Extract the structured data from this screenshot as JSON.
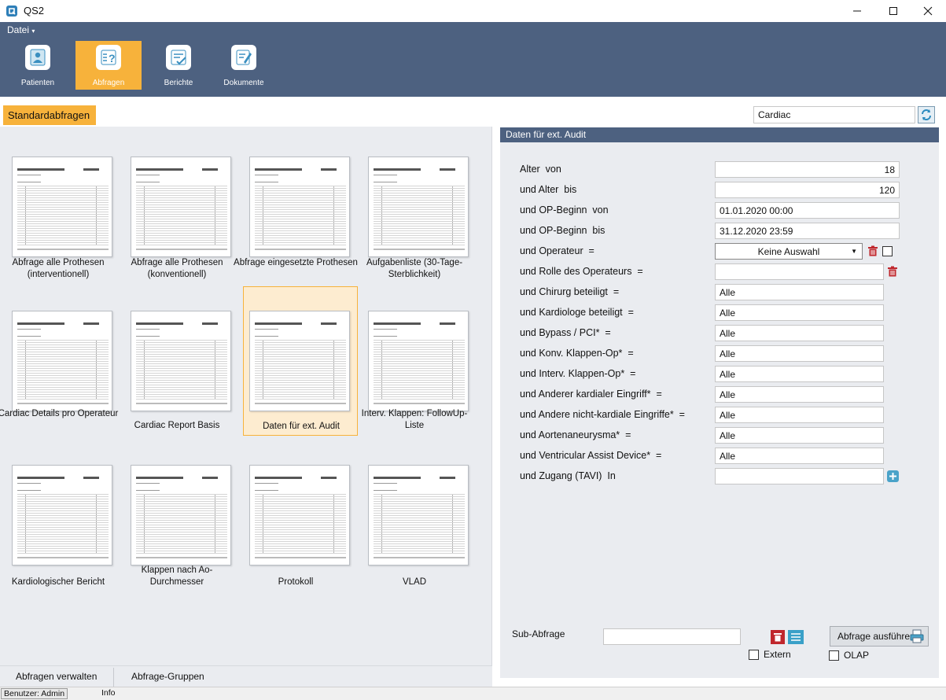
{
  "window": {
    "title": "QS2"
  },
  "ribbon": {
    "menu_label": "Datei",
    "buttons": [
      {
        "label": "Patienten",
        "icon": "patient-icon"
      },
      {
        "label": "Abfragen",
        "icon": "question-doc-icon"
      },
      {
        "label": "Berichte",
        "icon": "checklist-icon"
      },
      {
        "label": "Dokumente",
        "icon": "edit-doc-icon"
      }
    ],
    "active_index": 1
  },
  "toolbar": {
    "tab_label": "Standardabfragen",
    "search_value": "Cardiac"
  },
  "queries": {
    "selected_index": 6,
    "items": [
      {
        "label": "Abfrage alle Prothesen (interventionell)"
      },
      {
        "label": "Abfrage alle Prothesen (konventionell)"
      },
      {
        "label": "Abfrage eingesetzte Prothesen"
      },
      {
        "label": "Aufgabenliste (30-Tage-Sterblichkeit)"
      },
      {
        "label": "Cardiac Details pro Operateur"
      },
      {
        "label": "Cardiac Report Basis"
      },
      {
        "label": "Daten für ext. Audit"
      },
      {
        "label": "Interv. Klappen: FollowUp-Liste"
      },
      {
        "label": "Kardiologischer Bericht"
      },
      {
        "label": "Klappen nach Ao-Durchmesser"
      },
      {
        "label": "Protokoll"
      },
      {
        "label": "VLAD"
      }
    ]
  },
  "left_footer": {
    "manage_label": "Abfragen verwalten",
    "groups_label": "Abfrage-Gruppen"
  },
  "detail": {
    "header": "Daten für ext. Audit",
    "fields": [
      {
        "label": "Alter  von",
        "value": "18"
      },
      {
        "label": "und Alter  bis",
        "value": "120"
      },
      {
        "label": "und OP-Beginn  von",
        "value": "01.01.2020 00:00"
      },
      {
        "label": "und OP-Beginn  bis",
        "value": "31.12.2020 23:59"
      },
      {
        "label": "und Operateur  =",
        "value": "Keine Auswahl"
      },
      {
        "label": "und Rolle des Operateurs  =",
        "value": ""
      },
      {
        "label": "und Chirurg beteiligt  =",
        "value": "Alle"
      },
      {
        "label": "und Kardiologe beteiligt  =",
        "value": "Alle"
      },
      {
        "label": "und Bypass / PCI*  =",
        "value": "Alle"
      },
      {
        "label": "und Konv. Klappen-Op*  =",
        "value": "Alle"
      },
      {
        "label": "und Interv. Klappen-Op*  =",
        "value": "Alle"
      },
      {
        "label": "und Anderer kardialer Eingriff*  =",
        "value": "Alle"
      },
      {
        "label": "und Andere nicht-kardiale Eingriffe*  =",
        "value": "Alle"
      },
      {
        "label": "und Aortenaneurysma*  =",
        "value": "Alle"
      },
      {
        "label": "und Ventricular Assist Device*  =",
        "value": "Alle"
      },
      {
        "label": "und Zugang (TAVI)  In",
        "value": ""
      }
    ],
    "sub_query_label": "Sub-Abfrage",
    "sub_query_value": "",
    "run_label": "Abfrage ausführen",
    "extern_label": "Extern",
    "olap_label": "OLAP"
  },
  "statusbar": {
    "user": "Benutzer: Admin",
    "info": "Info"
  },
  "colors": {
    "accent": "#f7b23b",
    "ribbon": "#4d6180",
    "panel": "#eaecf0"
  }
}
